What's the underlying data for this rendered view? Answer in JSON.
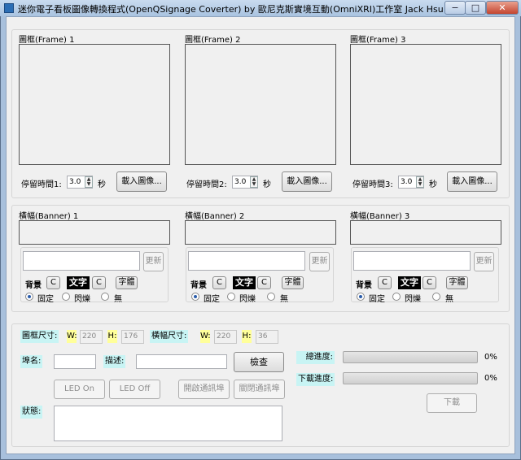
{
  "window": {
    "title": "迷你電子看板圖像轉換程式(OpenQSignage Coverter) by 歐尼克斯實境互動(OmniXRI)工作室 Jack Hsu",
    "minimize": "−",
    "maximize": "□",
    "close": "✕"
  },
  "frames": [
    {
      "label": "圖框(Frame) 1",
      "stay_label": "停留時間1:",
      "stay_value": "3.0",
      "unit": "秒",
      "load_button": "載入圖像..."
    },
    {
      "label": "圖框(Frame) 2",
      "stay_label": "停留時間2:",
      "stay_value": "3.0",
      "unit": "秒",
      "load_button": "載入圖像..."
    },
    {
      "label": "圖框(Frame) 3",
      "stay_label": "停留時間3:",
      "stay_value": "3.0",
      "unit": "秒",
      "load_button": "載入圖像..."
    }
  ],
  "banners": [
    {
      "label": "橫幅(Banner) 1",
      "text_value": "",
      "update_button": "更新",
      "bg_label": "背景",
      "bg_btn": "C",
      "text_label": "文字",
      "text_btn": "C",
      "font_btn": "字體",
      "opt_fixed": "固定",
      "opt_blink": "閃爍",
      "opt_none": "無",
      "selected": "固定"
    },
    {
      "label": "橫幅(Banner) 2",
      "text_value": "",
      "update_button": "更新",
      "bg_label": "背景",
      "bg_btn": "C",
      "text_label": "文字",
      "text_btn": "C",
      "font_btn": "字體",
      "opt_fixed": "固定",
      "opt_blink": "閃爍",
      "opt_none": "無",
      "selected": "固定"
    },
    {
      "label": "橫幅(Banner) 3",
      "text_value": "",
      "update_button": "更新",
      "bg_label": "背景",
      "bg_btn": "C",
      "text_label": "文字",
      "text_btn": "C",
      "font_btn": "字體",
      "opt_fixed": "固定",
      "opt_blink": "閃爍",
      "opt_none": "無",
      "selected": "固定"
    }
  ],
  "bottom": {
    "frame_size_label": "圖框尺寸:",
    "w_label": "W:",
    "frame_w": "220",
    "h_label": "H:",
    "frame_h": "176",
    "banner_size_label": "橫幅尺寸:",
    "banner_w": "220",
    "banner_h": "36",
    "port_label": "埠名:",
    "port_value": "",
    "desc_label": "描述:",
    "desc_value": "",
    "check_button": "檢查",
    "led_on": "LED On",
    "led_off": "LED Off",
    "open_port": "開啟通訊埠",
    "close_port": "關閉通訊埠",
    "status_label": "狀態:",
    "status_value": "",
    "total_progress_label": "總進度:",
    "total_progress": 0,
    "total_progress_text": "0%",
    "download_progress_label": "下載進度:",
    "download_progress": 0,
    "download_progress_text": "0%",
    "download_button": "下載"
  },
  "colors": {
    "label_highlight": "#c8f4f4",
    "wh_highlight": "#ffff9a",
    "window_frame": "#a8c0dc"
  }
}
